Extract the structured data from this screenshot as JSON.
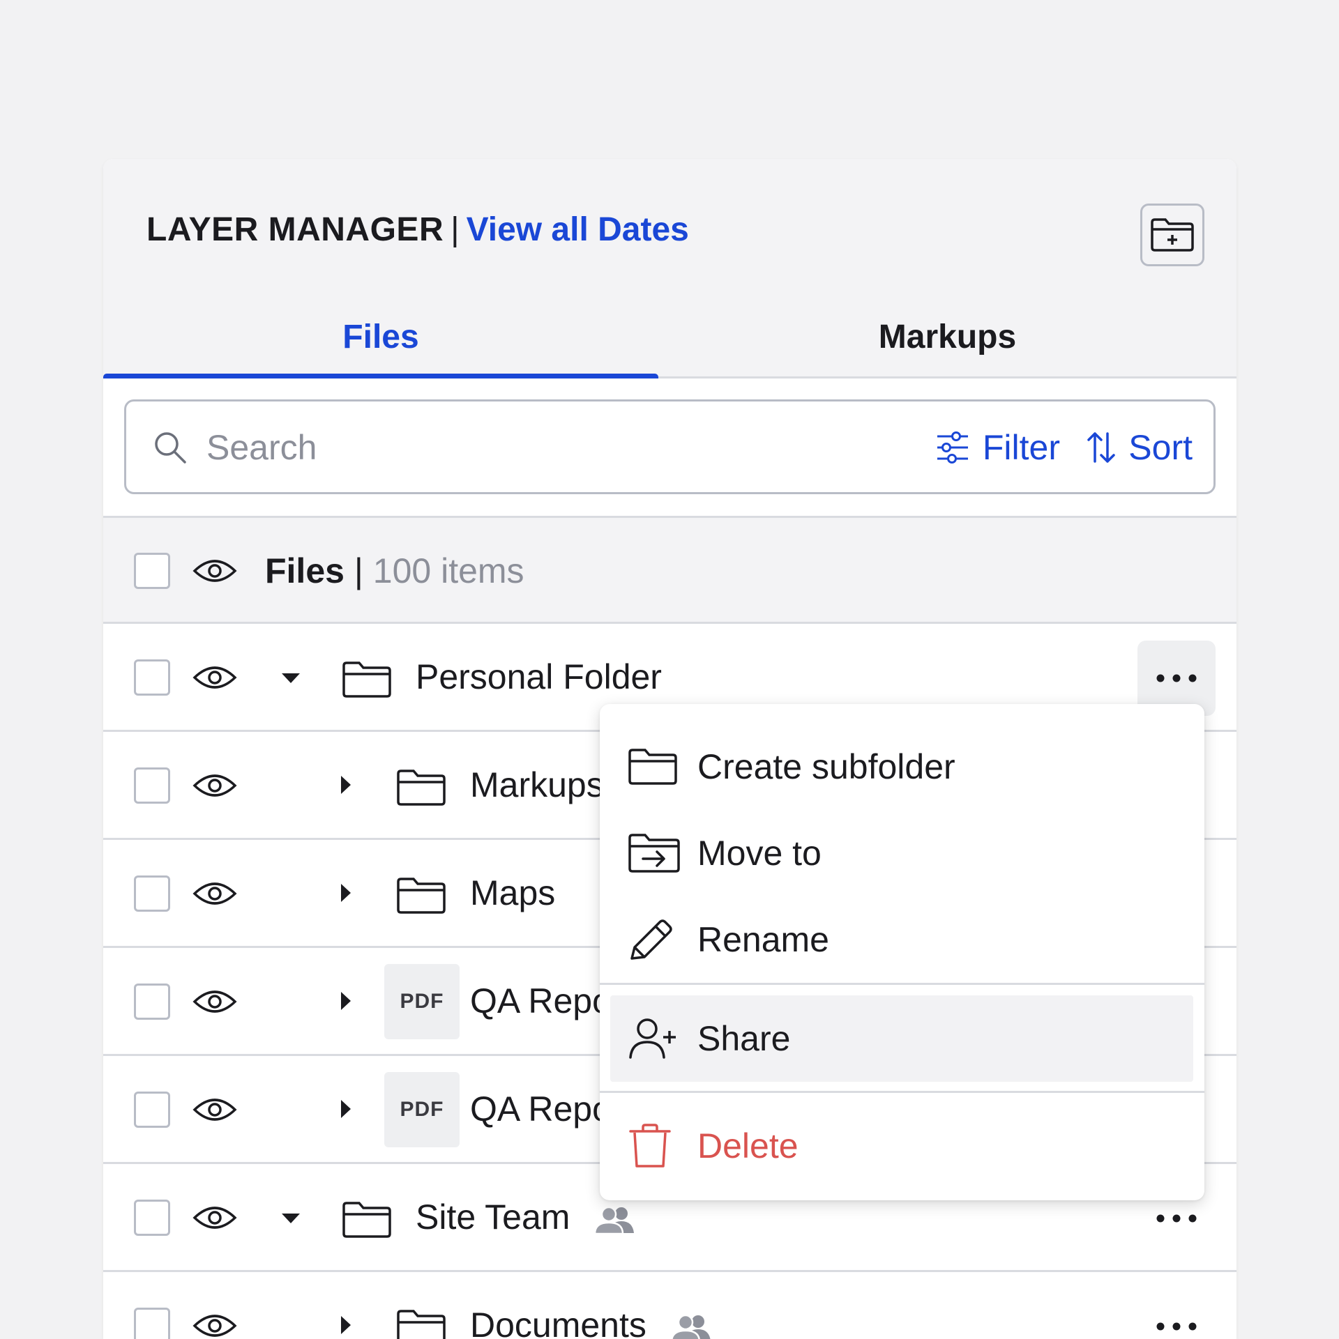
{
  "header": {
    "title": "LAYER MANAGER",
    "separator": "|",
    "link": "View all Dates",
    "add_folder_icon": "folder-plus-icon"
  },
  "tabs": [
    {
      "label": "Files",
      "active": true
    },
    {
      "label": "Markups",
      "active": false
    }
  ],
  "search": {
    "placeholder": "Search",
    "filter_label": "Filter",
    "sort_label": "Sort"
  },
  "list_header": {
    "label": "Files",
    "separator": "|",
    "count": "100 items"
  },
  "rows": [
    {
      "label": "Personal Folder",
      "type": "folder",
      "expanded": true,
      "shared": false
    },
    {
      "label": "Markups",
      "type": "folder",
      "expanded": false,
      "shared": false
    },
    {
      "label": "Maps",
      "type": "folder",
      "expanded": false,
      "shared": false
    },
    {
      "label": "QA Repo",
      "type": "pdf",
      "badge": "PDF",
      "expanded": false,
      "shared": false
    },
    {
      "label": "QA Repo",
      "type": "pdf",
      "badge": "PDF",
      "expanded": false,
      "shared": false
    },
    {
      "label": "Site Team",
      "type": "folder",
      "expanded": true,
      "shared": true
    },
    {
      "label": "Documents",
      "type": "folder",
      "expanded": false,
      "shared": true
    }
  ],
  "context_menu": {
    "items": [
      {
        "label": "Create subfolder",
        "icon": "folder-icon"
      },
      {
        "label": "Move to",
        "icon": "folder-move-icon"
      },
      {
        "label": "Rename",
        "icon": "pencil-icon"
      },
      {
        "label": "Share",
        "icon": "user-plus-icon"
      },
      {
        "label": "Delete",
        "icon": "trash-icon"
      }
    ]
  },
  "colors": {
    "accent": "#1a47d6",
    "danger": "#d9534f",
    "muted": "#8c8f99",
    "border": "#d9dbe0"
  }
}
